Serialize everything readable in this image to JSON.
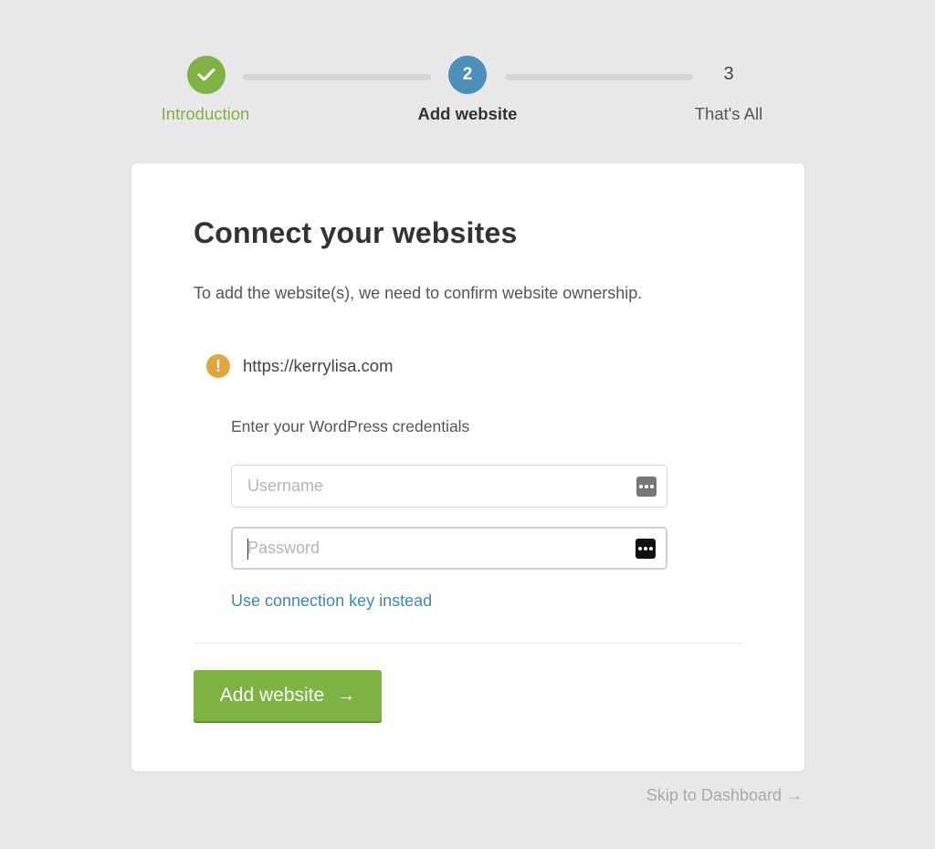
{
  "stepper": {
    "steps": [
      {
        "number": "1",
        "label": "Introduction",
        "state": "completed",
        "icon": "checkmark-icon"
      },
      {
        "number": "2",
        "label": "Add website",
        "state": "active"
      },
      {
        "number": "3",
        "label": "That's All",
        "state": "upcoming"
      }
    ]
  },
  "card": {
    "title": "Connect your websites",
    "subtitle": "To add the website(s), we need to confirm website ownership.",
    "site": {
      "url": "https://kerrylisa.com",
      "status_icon": "warning-icon",
      "status_icon_glyph": "!"
    },
    "credentials_label": "Enter your WordPress credentials",
    "username": {
      "value": "",
      "placeholder": "Username"
    },
    "password": {
      "value": "",
      "placeholder": "Password"
    },
    "connection_key_link": "Use connection key instead",
    "add_button": {
      "label": "Add website",
      "arrow": "→"
    }
  },
  "skip_link": "Skip to Dashboard →",
  "colors": {
    "background": "#e8e8e8",
    "accent_green": "#7cb342",
    "active_blue": "#4a90b8",
    "link_blue": "#3b8bb0",
    "warning": "#e2a73b"
  }
}
